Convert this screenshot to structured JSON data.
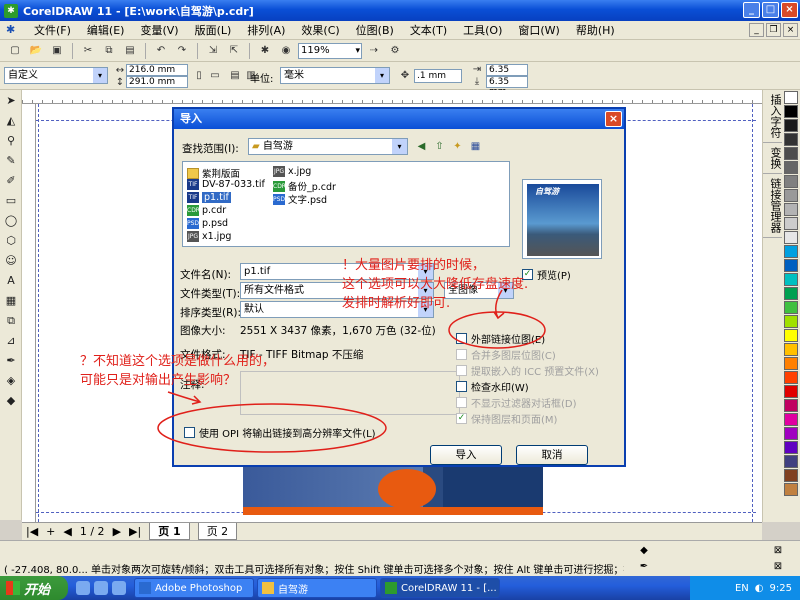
{
  "window": {
    "title": "CorelDRAW 11 - [E:\\work\\自驾游\\p.cdr]",
    "app_icon": "CorelDRAW-icon"
  },
  "menu": [
    "文件(F)",
    "编辑(E)",
    "变量(V)",
    "版面(L)",
    "排列(A)",
    "效果(C)",
    "位图(B)",
    "文本(T)",
    "工具(O)",
    "窗口(W)",
    "帮助(H)"
  ],
  "toolbar": {
    "zoom": "119%"
  },
  "propbar": {
    "paper": "自定义",
    "width": "216.0 mm",
    "height": "291.0 mm",
    "unit_label": "单位:",
    "unit": "毫米",
    "nudge": ".1 mm",
    "dup_x": "6.35 mm",
    "dup_y": "6.35 mm"
  },
  "pagenav": {
    "counter": "1 / 2",
    "tab1": "页 1",
    "tab2": "页 2"
  },
  "status": {
    "text": "( -27.408, 80.0...   单击对象两次可旋转/倾斜；双击工具可选择所有对象；按住 Shift 键单击可选择多个对象；按住 Alt 键单击可进行挖掘；按..."
  },
  "taskbar": {
    "start": "开始",
    "tasks": [
      "Adobe Photoshop",
      "自驾游",
      "CorelDRAW 11 - [..."
    ],
    "lang": "EN",
    "time": "9:25"
  },
  "dockers": [
    "插入字符",
    "变换",
    "链接管理器"
  ],
  "palette": [
    "#ffffff",
    "#000000",
    "#1a1a1a",
    "#333333",
    "#4d4d4d",
    "#666666",
    "#808080",
    "#999999",
    "#b3b3b3",
    "#cccccc",
    "#e6e6e6",
    "#00a0e0",
    "#0060c0",
    "#00c0c0",
    "#00a050",
    "#40c040",
    "#a0e000",
    "#ffff00",
    "#ffc000",
    "#ff8000",
    "#ff4000",
    "#e00000",
    "#c00060",
    "#e000a0",
    "#a000c0",
    "#6000c0",
    "#404080",
    "#804020",
    "#c08040"
  ],
  "dialog": {
    "title": "导入",
    "lookin_label": "查找范围(I):",
    "lookin_value": "自驾游",
    "files": [
      {
        "name": "紫荆版面",
        "kind": "folder"
      },
      {
        "name": "DV-87-033.tif",
        "kind": "tif"
      },
      {
        "name": "p1.tif",
        "kind": "tif",
        "selected": true
      },
      {
        "name": "p.cdr",
        "kind": "cdr"
      },
      {
        "name": "p.psd",
        "kind": "psd"
      },
      {
        "name": "x1.jpg",
        "kind": "jpg"
      },
      {
        "name": "x.jpg",
        "kind": "jpg"
      },
      {
        "name": "备份_p.cdr",
        "kind": "cdr"
      },
      {
        "name": "文字.psd",
        "kind": "psd"
      }
    ],
    "filename_label": "文件名(N):",
    "filename_value": "p1.tif",
    "filetype_label": "文件类型(T):",
    "filetype_value": "所有文件格式",
    "sort_label": "排序类型(R):",
    "sort_value": "默认",
    "size_label": "图像大小:",
    "size_value": "2551 X 3437 像素，1,670 万色 (32-位)",
    "format_label": "文件格式:",
    "format_value": "TIF - TIFF Bitmap 不压缩",
    "notes_label": "注释:",
    "fullimage_value": "全图像",
    "preview_label": "预览(P)",
    "preview_brand": "自驾游",
    "options": [
      {
        "label": "外部链接位图(E)",
        "checked": false,
        "disabled": false
      },
      {
        "label": "合并多图层位图(C)",
        "checked": false,
        "disabled": true
      },
      {
        "label": "提取嵌入的 ICC 预置文件(X)",
        "checked": false,
        "disabled": true
      },
      {
        "label": "检查水印(W)",
        "checked": false,
        "disabled": false
      },
      {
        "label": "不显示过滤器对话框(D)",
        "checked": false,
        "disabled": true
      },
      {
        "label": "保持图层和页面(M)",
        "checked": true,
        "disabled": true
      }
    ],
    "opi_label": "使用 OPI 将输出链接到高分辨率文件(L)",
    "import_button": "导入",
    "cancel_button": "取消"
  },
  "annotations": {
    "right": [
      "！大量图片要排的时候，",
      "这个选项可以大大降低存盘速度.",
      "发排时解析好即可."
    ],
    "left": [
      "？不知道这个选项是做什么用的，",
      "可能只是对输出产生影响？"
    ]
  }
}
